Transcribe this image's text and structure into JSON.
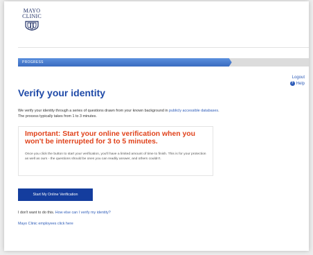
{
  "logo": {
    "line1": "MAYO",
    "line2": "CLINIC"
  },
  "progress": {
    "label": "PROGRESS",
    "value": 0.735,
    "fill_color": "#3a6cc0"
  },
  "header_links": {
    "logout": "Logout",
    "help": "Help"
  },
  "title": "Verify your identity",
  "intro": {
    "text_before_link": "We verify your identity through a series of questions drawn from your known background in ",
    "link": "publicly accessible databases",
    "text_after_link": ". The process typically takes from 1 to 3 minutes."
  },
  "important": {
    "heading": "Important: Start your online verification when you won't be interrupted for 3 to 5 minutes.",
    "body": "Once you click the button to start your verification, you'll have a limited amount of time to finish. This is for your protection as well as ours - the questions should be ones you can readily answer, and others couldn't."
  },
  "start_button": "Start My Online Verification",
  "alternative": {
    "text": "I don't want to do this. ",
    "link": "How else can I verify my identity?"
  },
  "employees_link": "Mayo Clinic employees click here",
  "colors": {
    "title": "#1f4aa8",
    "important": "#e0421b",
    "button": "#143d9e",
    "link": "#2e5cb8"
  }
}
